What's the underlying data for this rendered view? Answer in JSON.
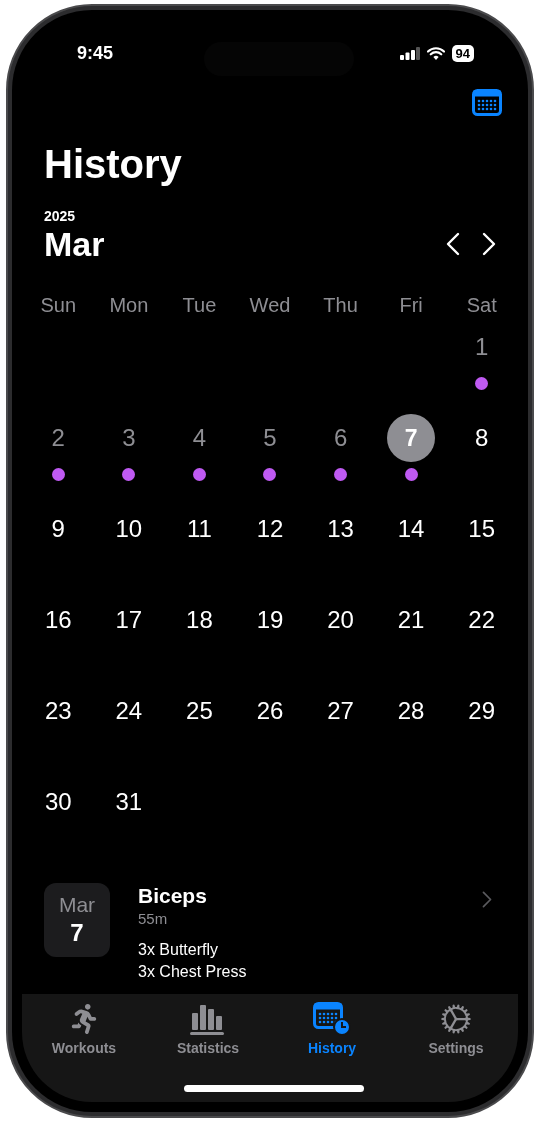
{
  "status_bar": {
    "time": "9:45",
    "battery": "94"
  },
  "header": {
    "title": "History",
    "year": "2025",
    "month": "Mar"
  },
  "weekdays": [
    "Sun",
    "Mon",
    "Tue",
    "Wed",
    "Thu",
    "Fri",
    "Sat"
  ],
  "weeks": [
    {
      "days": [
        {
          "label": "1",
          "dimmed": true,
          "has_workout": true,
          "selected": false
        }
      ]
    },
    {
      "days": [
        {
          "label": "2",
          "dimmed": true,
          "has_workout": true,
          "selected": false
        },
        {
          "label": "3",
          "dimmed": true,
          "has_workout": true,
          "selected": false
        },
        {
          "label": "4",
          "dimmed": true,
          "has_workout": true,
          "selected": false
        },
        {
          "label": "5",
          "dimmed": true,
          "has_workout": true,
          "selected": false
        },
        {
          "label": "6",
          "dimmed": true,
          "has_workout": true,
          "selected": false
        },
        {
          "label": "7",
          "dimmed": false,
          "has_workout": true,
          "selected": true
        },
        {
          "label": "8",
          "dimmed": false,
          "has_workout": false,
          "selected": false
        }
      ]
    },
    {
      "days": [
        {
          "label": "9",
          "dimmed": false,
          "has_workout": false,
          "selected": false
        },
        {
          "label": "10",
          "dimmed": false,
          "has_workout": false,
          "selected": false
        },
        {
          "label": "11",
          "dimmed": false,
          "has_workout": false,
          "selected": false
        },
        {
          "label": "12",
          "dimmed": false,
          "has_workout": false,
          "selected": false
        },
        {
          "label": "13",
          "dimmed": false,
          "has_workout": false,
          "selected": false
        },
        {
          "label": "14",
          "dimmed": false,
          "has_workout": false,
          "selected": false
        },
        {
          "label": "15",
          "dimmed": false,
          "has_workout": false,
          "selected": false
        }
      ]
    },
    {
      "days": [
        {
          "label": "16",
          "dimmed": false,
          "has_workout": false,
          "selected": false
        },
        {
          "label": "17",
          "dimmed": false,
          "has_workout": false,
          "selected": false
        },
        {
          "label": "18",
          "dimmed": false,
          "has_workout": false,
          "selected": false
        },
        {
          "label": "19",
          "dimmed": false,
          "has_workout": false,
          "selected": false
        },
        {
          "label": "20",
          "dimmed": false,
          "has_workout": false,
          "selected": false
        },
        {
          "label": "21",
          "dimmed": false,
          "has_workout": false,
          "selected": false
        },
        {
          "label": "22",
          "dimmed": false,
          "has_workout": false,
          "selected": false
        }
      ]
    },
    {
      "days": [
        {
          "label": "23",
          "dimmed": false,
          "has_workout": false,
          "selected": false
        },
        {
          "label": "24",
          "dimmed": false,
          "has_workout": false,
          "selected": false
        },
        {
          "label": "25",
          "dimmed": false,
          "has_workout": false,
          "selected": false
        },
        {
          "label": "26",
          "dimmed": false,
          "has_workout": false,
          "selected": false
        },
        {
          "label": "27",
          "dimmed": false,
          "has_workout": false,
          "selected": false
        },
        {
          "label": "28",
          "dimmed": false,
          "has_workout": false,
          "selected": false
        },
        {
          "label": "29",
          "dimmed": false,
          "has_workout": false,
          "selected": false
        }
      ]
    },
    {
      "days": [
        {
          "label": "30",
          "dimmed": false,
          "has_workout": false,
          "selected": false
        },
        {
          "label": "31",
          "dimmed": false,
          "has_workout": false,
          "selected": false
        }
      ]
    }
  ],
  "workouts": [
    {
      "month": "Mar",
      "day": "7",
      "title": "Biceps",
      "duration": "55m",
      "exercises": [
        "3x Butterfly",
        "3x Chest Press"
      ]
    }
  ],
  "tabs": [
    {
      "label": "Workouts",
      "kind": "runner",
      "selected": false
    },
    {
      "label": "Statistics",
      "kind": "bars",
      "selected": false
    },
    {
      "label": "History",
      "kind": "calendar",
      "selected": true
    },
    {
      "label": "Settings",
      "kind": "gear",
      "selected": false
    }
  ]
}
